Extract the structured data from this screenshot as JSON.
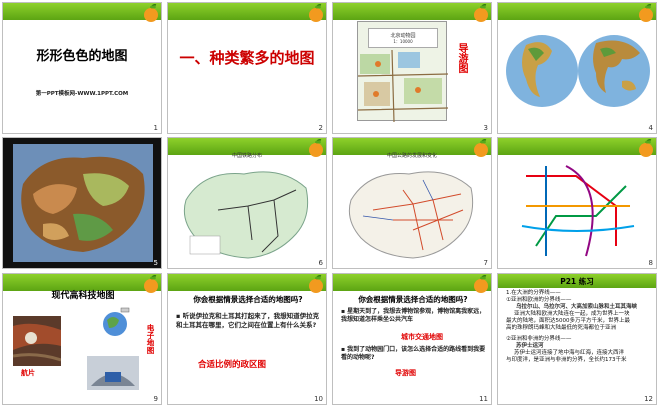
{
  "slides": [
    {
      "num": "1",
      "title": "形形色色的地图",
      "subtitle": "第一PPT模板网-WWW.1PPT.COM"
    },
    {
      "num": "2",
      "title": "一、种类繁多的地图"
    },
    {
      "num": "3",
      "map_title": "北京动物园",
      "map_scale": "1：10000",
      "side_label": "导游图"
    },
    {
      "num": "4"
    },
    {
      "num": "5"
    },
    {
      "num": "6",
      "map_title": "中国铁路分布"
    },
    {
      "num": "7",
      "map_title": "中国公路的发展和变化"
    },
    {
      "num": "8"
    },
    {
      "num": "9",
      "title": "现代高科技地图",
      "side_label": "电子地图",
      "caption": "航片"
    },
    {
      "num": "10",
      "title": "你会根据情景选择合适的地图吗?",
      "question": "听说伊拉克和土耳其打起来了，我想知道伊拉克和土耳其在哪里，它们之间在位置上有什么关系?",
      "answer": "合适比例的政区图"
    },
    {
      "num": "11",
      "title": "你会根据情景选择合适的地图吗?",
      "q1": "星期天到了，我想去博物馆参观，博物馆离我家远，我想知道怎样乘坐公共汽车",
      "a1": "城市交通地图",
      "q2": "我到了动物园门口，该怎么选择合适的路线看到我要看的动物呢?",
      "a2": "导游图"
    },
    {
      "num": "12",
      "title": "P21 练习",
      "lines": [
        "1.在大洲的分界线——",
        "①亚洲和欧洲的分界线——",
        "乌拉尔山、乌拉尔河、大高加索山脉和土耳其海峡",
        "亚洲大陆和欧洲大陆连在一起，成为世界上一块",
        "最大的陆地，面积达5000多万平方千米，世界上最",
        "高的珠穆朗玛峰和大陆最低的死海都位于亚洲",
        "②亚洲和非洲的分界线——",
        "苏伊士运河",
        "苏伊士运河连接了地中海与红海，连接大西洋",
        "与印度洋，是亚洲与非洲的分界，全长约173千米"
      ]
    }
  ]
}
